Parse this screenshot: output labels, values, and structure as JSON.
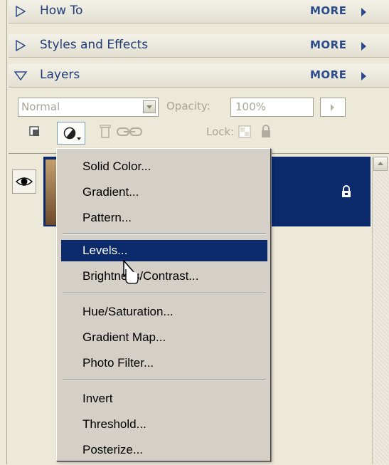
{
  "panels": [
    {
      "title": "How To",
      "more": "MORE"
    },
    {
      "title": "Styles and Effects",
      "more": "MORE"
    },
    {
      "title": "Layers",
      "more": "MORE"
    }
  ],
  "layers_panel": {
    "blend_mode": "Normal",
    "opacity_label": "Opacity:",
    "opacity_value": "100%",
    "lock_label": "Lock:"
  },
  "menu": {
    "groups": [
      [
        "Solid Color...",
        "Gradient...",
        "Pattern..."
      ],
      [
        "Levels...",
        "Brightness/Contrast..."
      ],
      [
        "Hue/Saturation...",
        "Gradient Map...",
        "Photo Filter..."
      ],
      [
        "Invert",
        "Threshold...",
        "Posterize..."
      ]
    ],
    "selected": "Levels..."
  },
  "colors": {
    "panel_text": "#1f3c78",
    "selection": "#0b2a6b",
    "menu_bg": "#d4d0c8"
  },
  "icons": [
    "triangle-right-icon",
    "triangle-down-icon",
    "new-fill-adjustment-icon",
    "link-icon",
    "trash-icon",
    "lock-icon",
    "eye-icon",
    "mouse-cursor-icon"
  ]
}
